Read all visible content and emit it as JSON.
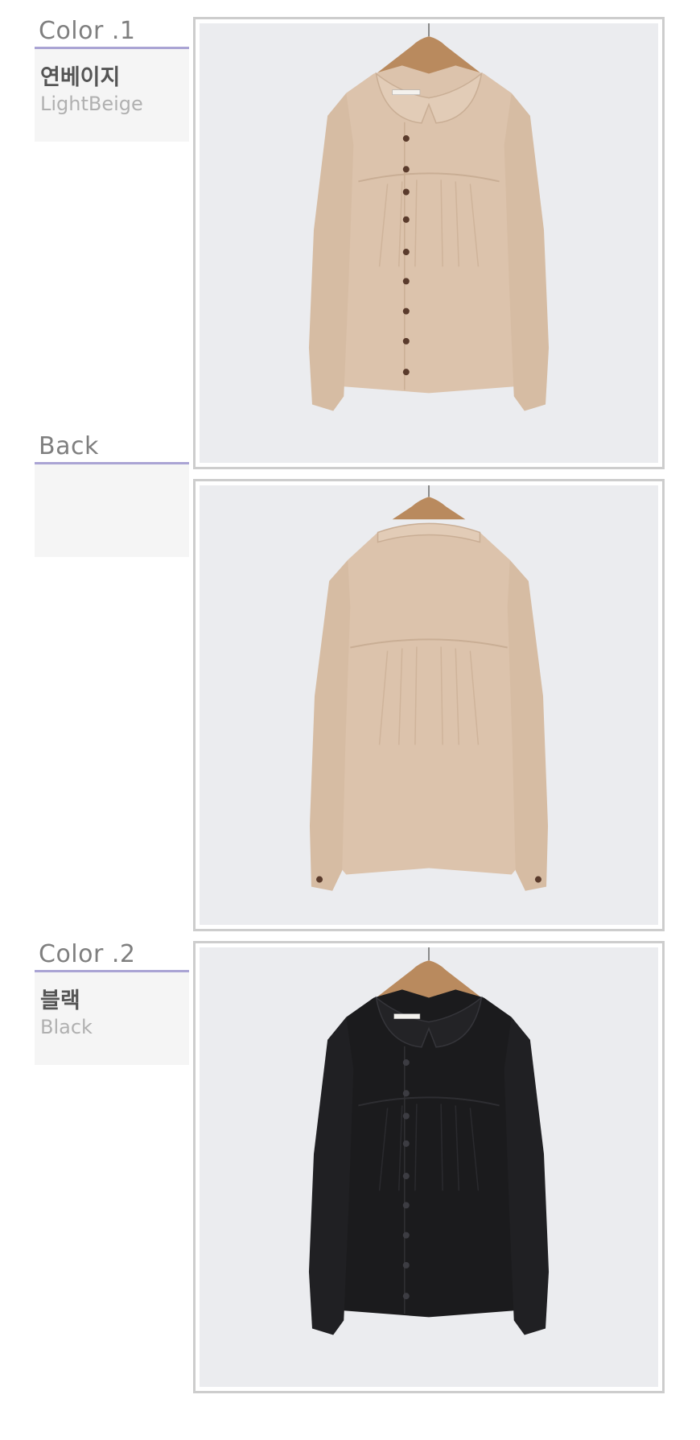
{
  "sections": [
    {
      "title": "Color .1",
      "name_ko": "연베이지",
      "name_en": "LightBeige",
      "garment_color": "#dcc3ac",
      "garment_view": "front"
    },
    {
      "title": "Back",
      "name_ko": "",
      "name_en": "",
      "garment_color": "#dcc3ac",
      "garment_view": "back"
    },
    {
      "title": "Color .2",
      "name_ko": "블랙",
      "name_en": "Black",
      "garment_color": "#1b1b1d",
      "garment_view": "front"
    }
  ],
  "colors": {
    "accent_line": "#aaa4d4",
    "label_bg": "#f5f5f5",
    "title_text": "#7f7f7f",
    "name_ko_text": "#555555",
    "name_en_text": "#b0b0b0",
    "frame_border": "#cdcdcd",
    "photo_bg": "#ebecef"
  }
}
